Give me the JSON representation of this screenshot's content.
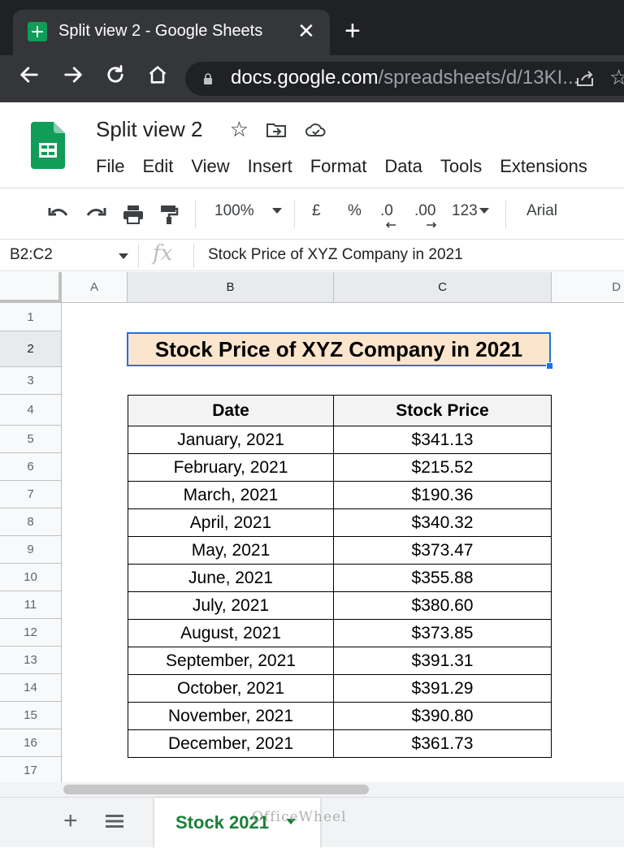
{
  "browser": {
    "tab_title": "Split view 2 - Google Sheets",
    "close_symbol": "✕",
    "newtab_symbol": "+",
    "url_host": "docs.google.com",
    "url_path": "/spreadsheets/d/13KI..."
  },
  "doc": {
    "title": "Split view 2",
    "menu": [
      "File",
      "Edit",
      "View",
      "Insert",
      "Format",
      "Data",
      "Tools",
      "Extensions"
    ]
  },
  "toolbar": {
    "zoom": "100%",
    "currency": "£",
    "percent": "%",
    "dec_decrease": ".0",
    "dec_increase": ".00",
    "more_formats": "123",
    "font": "Arial"
  },
  "formula_bar": {
    "name_box": "B2:C2",
    "fx": "fx",
    "content": "Stock Price of XYZ Company in 2021"
  },
  "grid": {
    "columns": [
      "A",
      "B",
      "C",
      "D"
    ],
    "rows": [
      "1",
      "2",
      "3",
      "4",
      "5",
      "6",
      "7",
      "8",
      "9",
      "10",
      "11",
      "12",
      "13",
      "14",
      "15",
      "16",
      "17"
    ],
    "title_cell": "Stock Price of XYZ Company in 2021",
    "table": {
      "headers": [
        "Date",
        "Stock Price"
      ],
      "rows": [
        [
          "January, 2021",
          "$341.13"
        ],
        [
          "February, 2021",
          "$215.52"
        ],
        [
          "March, 2021",
          "$190.36"
        ],
        [
          "April, 2021",
          "$340.32"
        ],
        [
          "May, 2021",
          "$373.47"
        ],
        [
          "June, 2021",
          "$355.88"
        ],
        [
          "July, 2021",
          "$380.60"
        ],
        [
          "August, 2021",
          "$373.85"
        ],
        [
          "September, 2021",
          "$391.31"
        ],
        [
          "October, 2021",
          "$391.29"
        ],
        [
          "November, 2021",
          "$390.80"
        ],
        [
          "December, 2021",
          "$361.73"
        ]
      ]
    }
  },
  "sheets": {
    "add_symbol": "+",
    "active_sheet": "Stock 2021",
    "watermark": "OfficeWheel"
  },
  "colors": {
    "title_fill": "#fce5cd",
    "selection": "#1a73e8",
    "sheet_tab": "#188038"
  }
}
